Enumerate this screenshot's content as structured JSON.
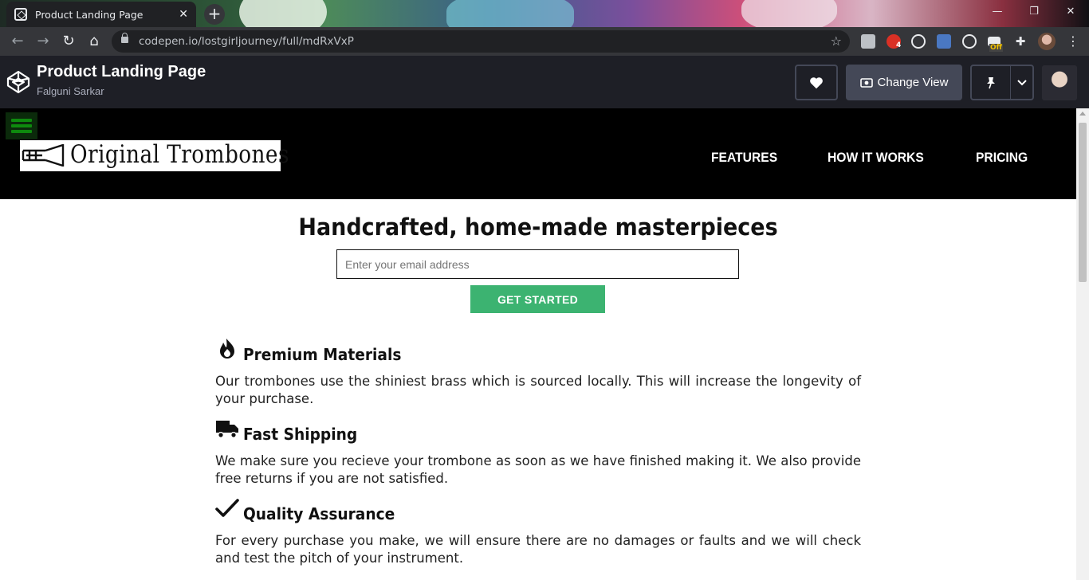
{
  "browser": {
    "tab_title": "Product Landing Page",
    "new_tab_symbol": "+",
    "url": "codepen.io/lostgirljourney/full/mdRxVxP",
    "extensions_badge": "4",
    "ext_off_label": "Off",
    "window_controls": {
      "minimize": "—",
      "restore": "❐",
      "close": "✕"
    }
  },
  "codepen": {
    "title": "Product Landing Page",
    "author": "Falguni Sarkar",
    "change_view_label": "Change View",
    "icons": [
      "heart-icon",
      "eye-icon",
      "pin-icon",
      "chevron-down-icon"
    ]
  },
  "site": {
    "logo_text": "Original Trombones",
    "nav": [
      {
        "label": "FEATURES"
      },
      {
        "label": "HOW IT WORKS"
      },
      {
        "label": "PRICING"
      }
    ],
    "hero": {
      "title": "Handcrafted, home-made masterpieces",
      "email_placeholder": "Enter your email address",
      "cta_label": "GET STARTED"
    },
    "features": [
      {
        "icon": "fire-icon",
        "title": "Premium Materials",
        "description": "Our trombones use the shiniest brass which is sourced locally. This will increase the longevity of your purchase."
      },
      {
        "icon": "truck-icon",
        "title": "Fast Shipping",
        "description": "We make sure you recieve your trombone as soon as we have finished making it. We also provide free returns if you are not satisfied."
      },
      {
        "icon": "check-icon",
        "title": "Quality Assurance",
        "description": "For every purchase you make, we will ensure there are no damages or faults and we will check and test the pitch of your instrument."
      }
    ]
  },
  "colors": {
    "codepen_header": "#1e1f26",
    "site_nav": "#000000",
    "cta_green": "#3cb371",
    "hamburger_green": "#0e8a0e"
  }
}
